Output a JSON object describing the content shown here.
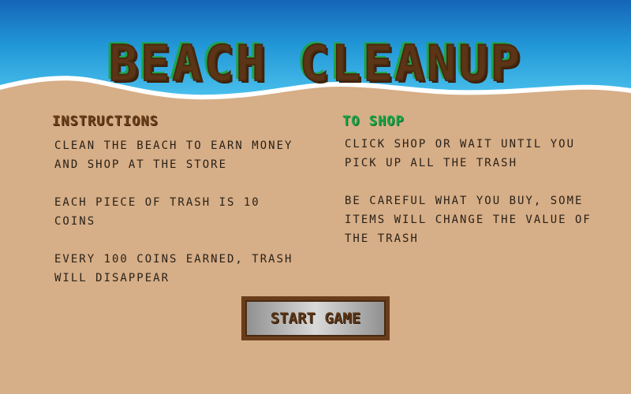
{
  "title": "BEACH CLEANUP",
  "instructions": {
    "heading": "INSTRUCTIONS",
    "paragraphs": [
      [
        "CLEAN THE BEACH TO EARN MONEY",
        "AND SHOP AT THE STORE"
      ],
      [
        "EACH PIECE OF TRASH IS 10",
        "COINS"
      ],
      [
        "EVERY 100 COINS EARNED, TRASH",
        "WILL DISAPPEAR"
      ]
    ]
  },
  "to_shop": {
    "heading": "TO SHOP",
    "paragraphs": [
      [
        "CLICK SHOP OR WAIT UNTIL YOU",
        "PICK UP ALL THE TRASH"
      ],
      [
        "BE CAREFUL WHAT YOU BUY, SOME",
        "ITEMS WILL CHANGE THE VALUE OF",
        "THE TRASH"
      ]
    ]
  },
  "start_button": {
    "label": "START GAME"
  },
  "colors": {
    "sand": "#d6ae87",
    "ocean_deep": "#1b6fc0",
    "ocean_light": "#3ab8e8",
    "foam": "#ffffff",
    "title_brown": "#5b3515",
    "title_green": "#1ea44d",
    "shop_green": "#19a447",
    "button_border": "#6a3d1a"
  }
}
